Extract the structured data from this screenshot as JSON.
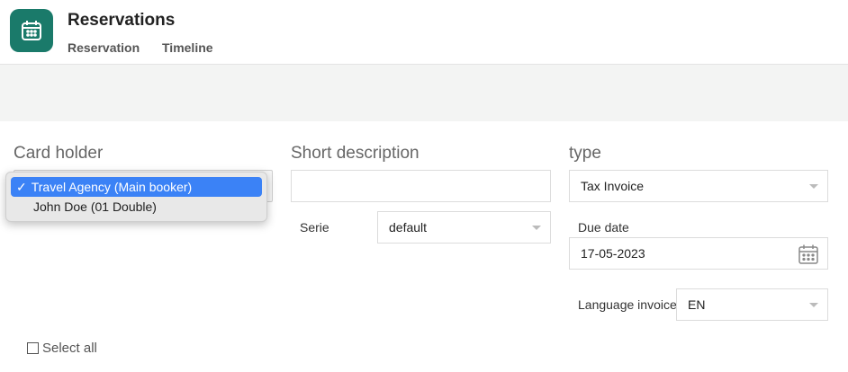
{
  "header": {
    "title": "Reservations",
    "tabs": [
      {
        "label": "Reservation"
      },
      {
        "label": "Timeline"
      }
    ]
  },
  "form": {
    "card_holder": {
      "label": "Card holder",
      "options": [
        {
          "label": "Travel Agency (Main booker)",
          "selected": true
        },
        {
          "label": "John Doe (01 Double)",
          "selected": false
        }
      ]
    },
    "short_description": {
      "label": "Short description",
      "value": ""
    },
    "serie": {
      "label": "Serie",
      "value": "default"
    },
    "type": {
      "label": "type",
      "value": "Tax Invoice"
    },
    "due_date": {
      "label": "Due date",
      "value": "17-05-2023"
    },
    "language_invoice": {
      "label": "Language invoice",
      "value": "EN"
    },
    "select_all": {
      "label": "Select all",
      "checked": false
    }
  },
  "colors": {
    "app_icon_bg": "#1a7a6a",
    "selected_option": "#3b82f6",
    "band": "#f3f4f3"
  }
}
